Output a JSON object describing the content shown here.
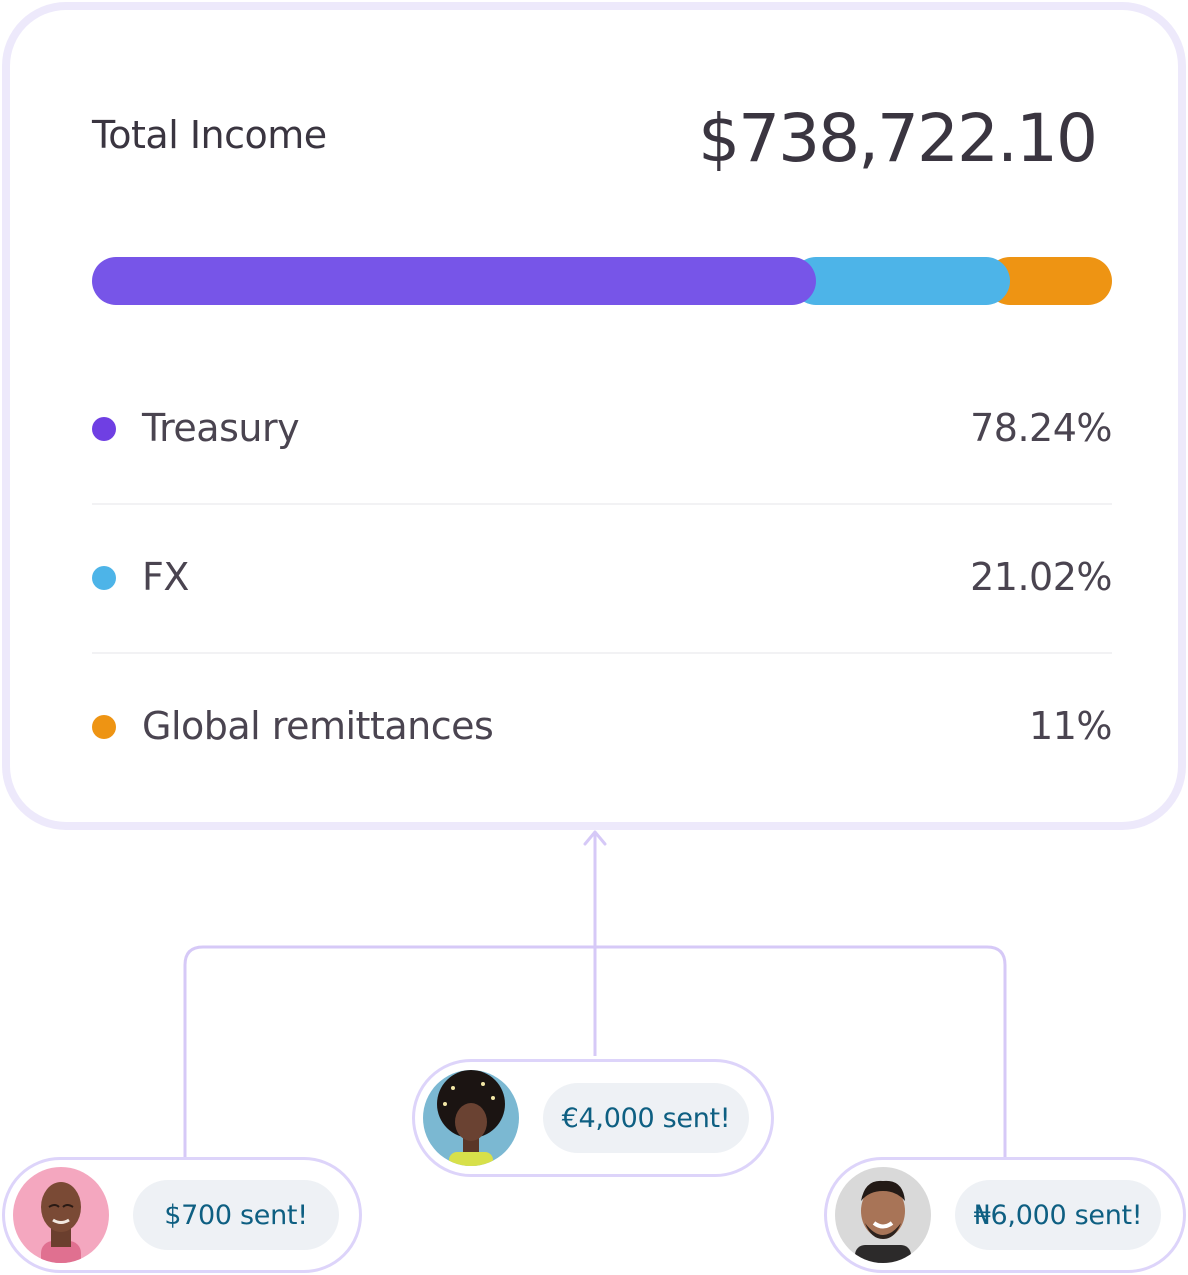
{
  "card": {
    "title": "Total Income",
    "amount": "$738,722.10"
  },
  "bar": {
    "segments": [
      {
        "name": "Treasury",
        "share": 0.7824,
        "color": "#7755e8"
      },
      {
        "name": "FX",
        "share": 0.2102,
        "color": "#4db4e8"
      },
      {
        "name": "Global remittances",
        "share": 0.11,
        "color": "#ee9413"
      }
    ]
  },
  "legend": [
    {
      "label": "Treasury",
      "value": "78.24%",
      "color": "#6f3fe3"
    },
    {
      "label": "FX",
      "value": "21.02%",
      "color": "#4db4e8"
    },
    {
      "label": "Global remittances",
      "value": "11%",
      "color": "#ee9413"
    }
  ],
  "transfers": [
    {
      "text": "$700 sent!",
      "avatar_bg": "#f4a7bf",
      "skin": "#7a4a35"
    },
    {
      "text": "€4,000 sent!",
      "avatar_bg": "#7bb8d2",
      "skin": "#6a4232"
    },
    {
      "text": "₦6,000 sent!",
      "avatar_bg": "#d9d9d9",
      "skin": "#a87457"
    }
  ],
  "colors": {
    "card_border": "#ede9fb",
    "connector": "#d6c9f7",
    "bubble_bg": "#eef1f5",
    "bubble_text": "#0e5f82"
  }
}
